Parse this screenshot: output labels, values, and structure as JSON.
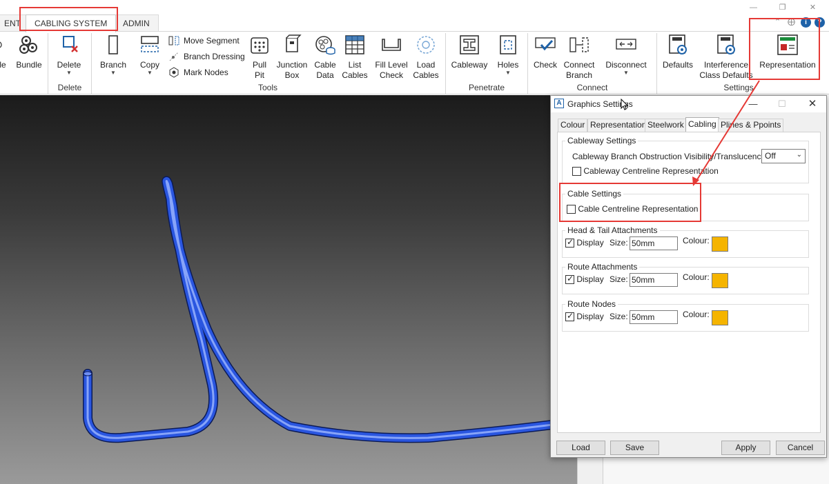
{
  "tabs": {
    "partial": "ENT",
    "active": "CABLING SYSTEM",
    "admin": "ADMIN"
  },
  "ribbon": {
    "buttons": {
      "partial_left": "le",
      "bundle": "Bundle",
      "delete": "Delete",
      "branch": "Branch",
      "copy": "Copy",
      "pull_pit": [
        "Pull",
        "Pit"
      ],
      "junction_box": [
        "Junction",
        "Box"
      ],
      "cable_data": [
        "Cable",
        "Data"
      ],
      "list_cables": [
        "List",
        "Cables"
      ],
      "fill_level_check": [
        "Fill Level",
        "Check"
      ],
      "load_cables": [
        "Load",
        "Cables"
      ],
      "cableway": "Cableway",
      "holes": "Holes",
      "check": "Check",
      "connect_branch": [
        "Connect",
        "Branch"
      ],
      "disconnect": "Disconnect",
      "defaults": "Defaults",
      "interference_class_defaults": [
        "Interference",
        "Class Defaults"
      ],
      "representation": "Representation"
    },
    "small_buttons": {
      "move_segment": "Move Segment",
      "branch_dressing": "Branch Dressing",
      "mark_nodes": "Mark Nodes"
    },
    "groups": {
      "delete": "Delete",
      "tools": "Tools",
      "penetrate": "Penetrate",
      "connect": "Connect",
      "settings": "Settings"
    }
  },
  "dialog": {
    "title": "Graphics Settings",
    "tabs": [
      "Colour",
      "Representation",
      "Steelwork",
      "Cabling",
      "Plines & Ppoints"
    ],
    "active_tab": "Cabling",
    "cableway_settings": {
      "title": "Cableway Settings",
      "obstruction_label": "Cableway Branch Obstruction Visibility/Translucency:",
      "obstruction_value": "Off",
      "centreline_label": "Cableway Centreline Representation",
      "centreline_checked": false
    },
    "cable_settings": {
      "title": "Cable Settings",
      "centreline_label": "Cable Centreline Representation",
      "centreline_checked": false
    },
    "head_tail": {
      "title": "Head & Tail Attachments",
      "display_label": "Display",
      "display_checked": true,
      "size_label": "Size:",
      "size_value": "50mm",
      "colour_label": "Colour:",
      "colour": "#f5b400"
    },
    "route_attachments": {
      "title": "Route Attachments",
      "display_label": "Display",
      "display_checked": true,
      "size_label": "Size:",
      "size_value": "50mm",
      "colour_label": "Colour:",
      "colour": "#f5b400"
    },
    "route_nodes": {
      "title": "Route Nodes",
      "display_label": "Display",
      "display_checked": true,
      "size_label": "Size:",
      "size_value": "50mm",
      "colour_label": "Colour:",
      "colour": "#f5b400"
    },
    "buttons": {
      "load": "Load",
      "save": "Save",
      "apply": "Apply",
      "cancel": "Cancel"
    }
  },
  "colors": {
    "annotation_red": "#e53935",
    "cable_blue": "#2a56e0",
    "accent_blue": "#1e62a8"
  }
}
